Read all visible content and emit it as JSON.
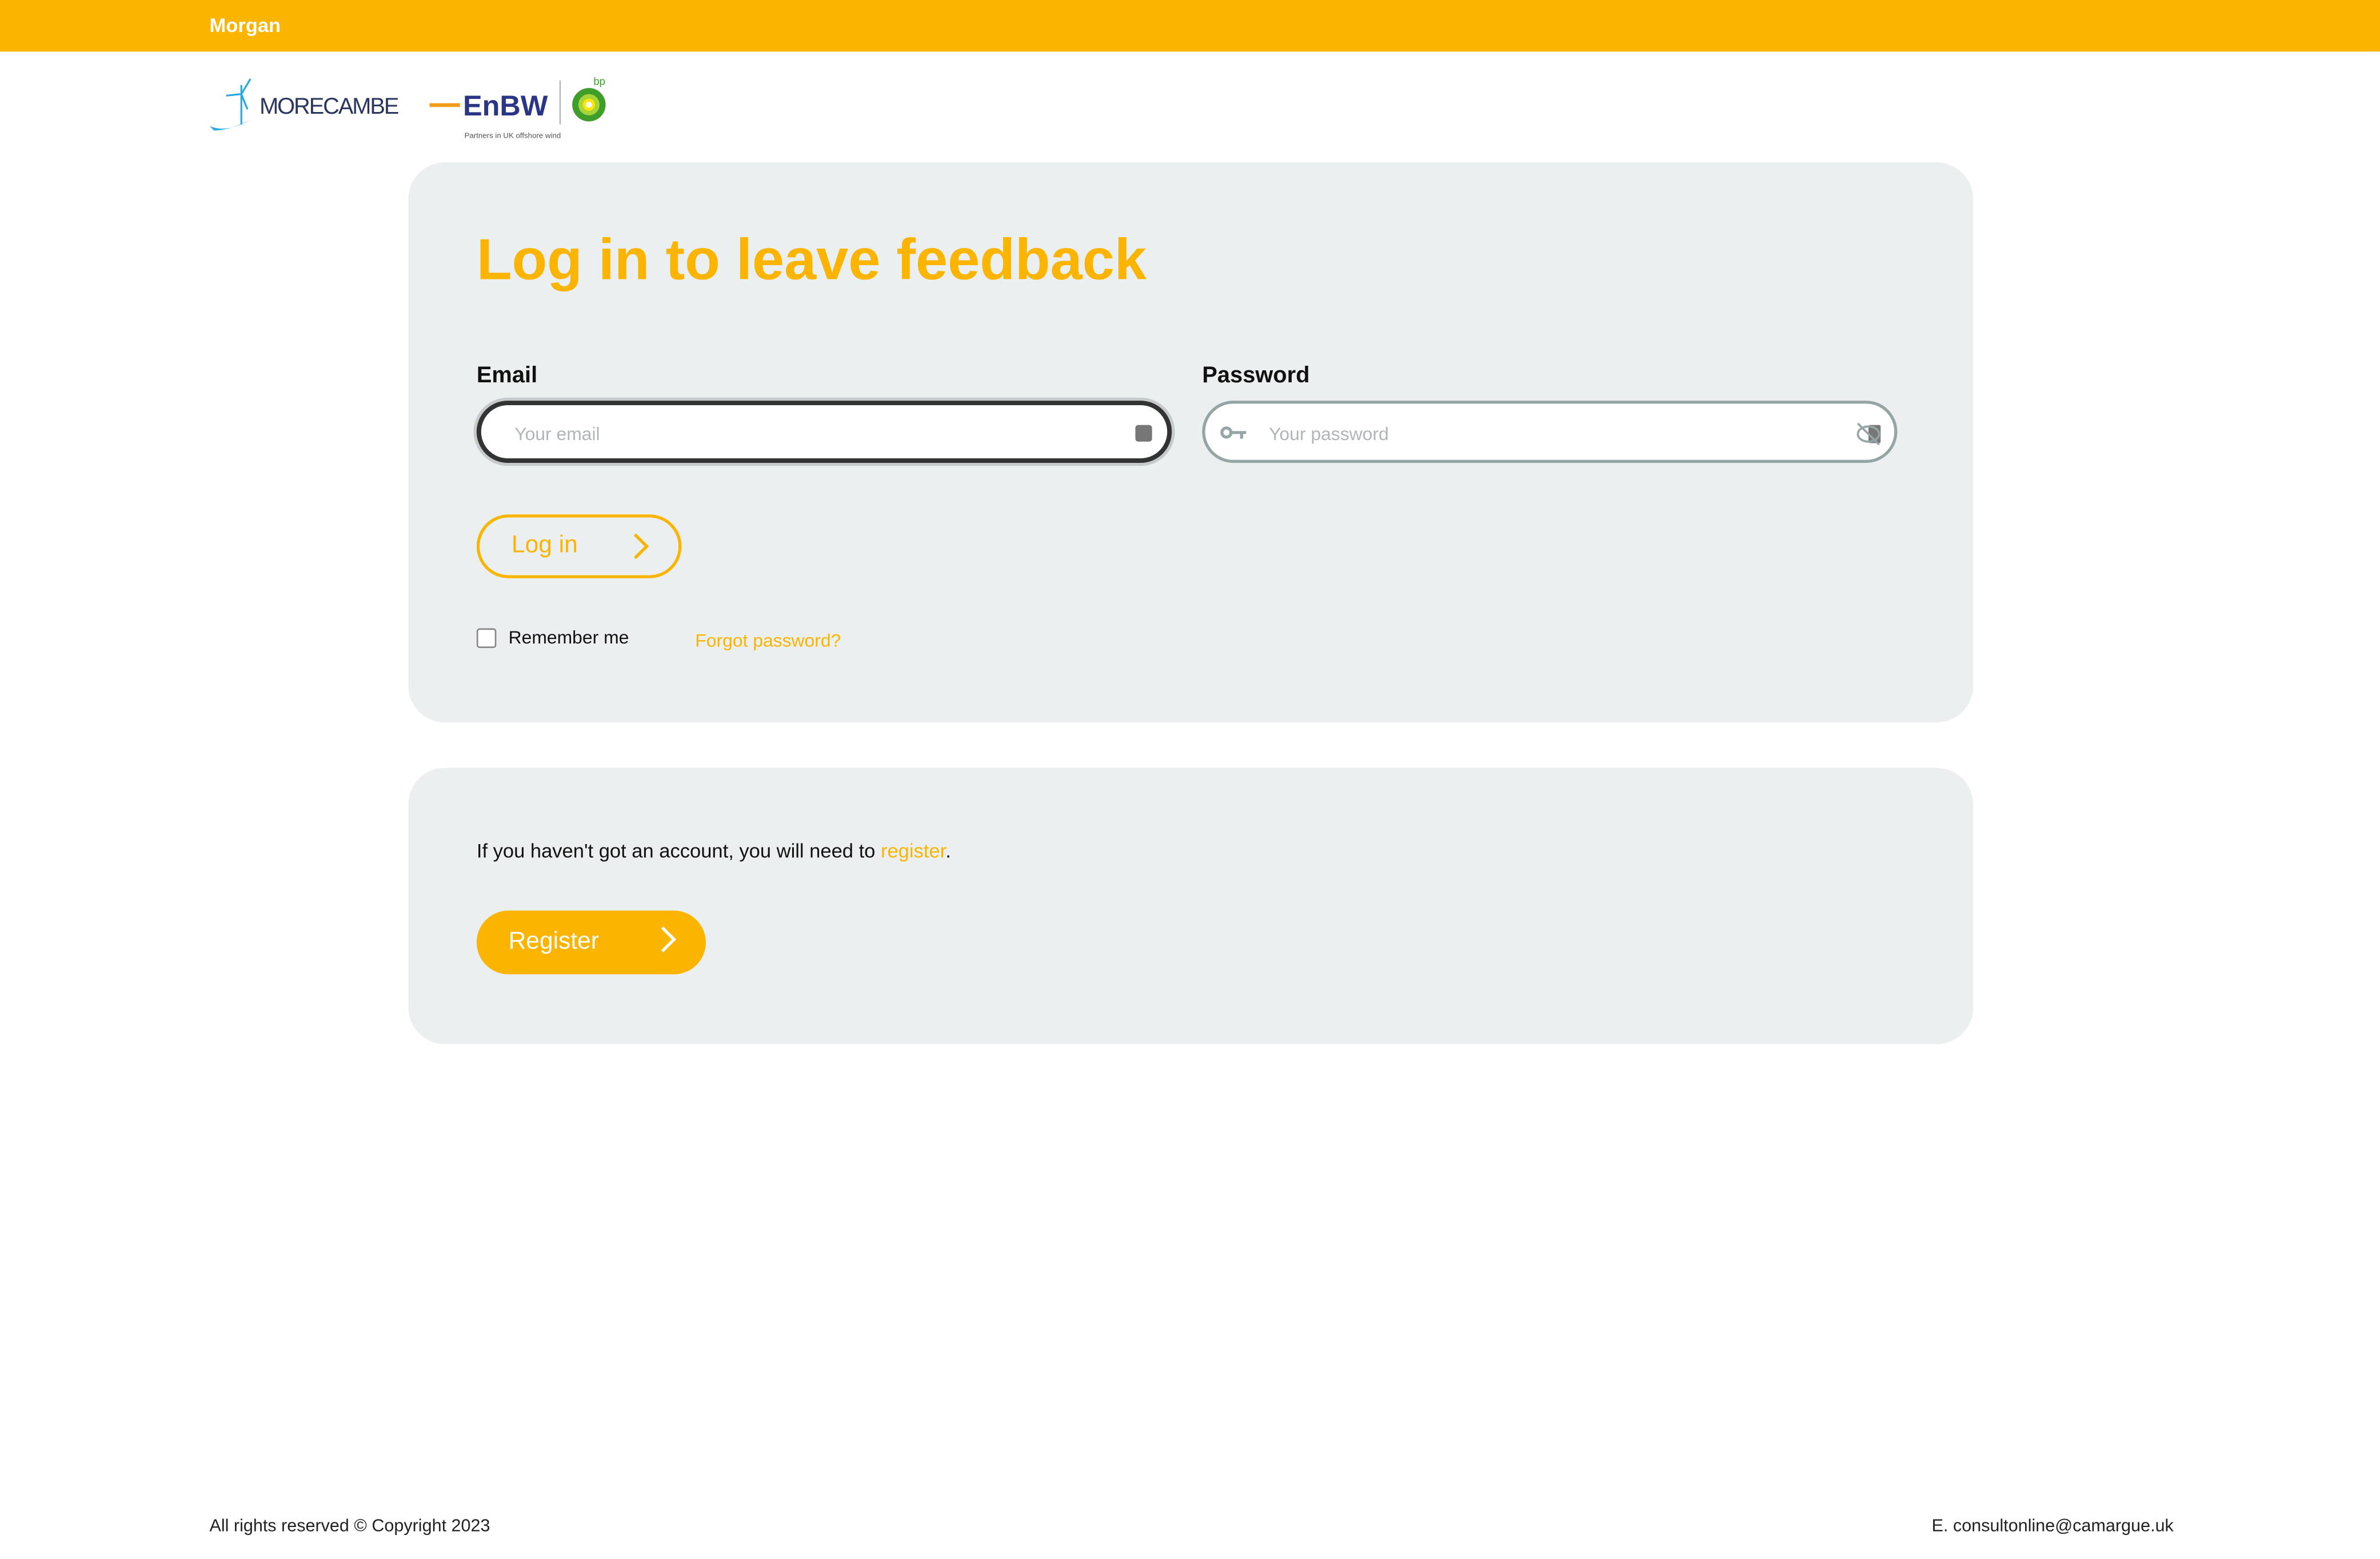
{
  "topbar": {
    "title": "Morgan"
  },
  "logos": {
    "morecambe": "MORECAMBE",
    "enbw": "EnBW",
    "bp": "bp",
    "tagline": "Partners in UK offshore wind"
  },
  "login": {
    "title": "Log in to leave feedback",
    "email_label": "Email",
    "email_placeholder": "Your email",
    "password_label": "Password",
    "password_placeholder": "Your password",
    "login_button": "Log in",
    "remember_label": "Remember me",
    "forgot_link": "Forgot password?"
  },
  "register": {
    "message_prefix": "If you haven't got an account, you will need to ",
    "message_link": "register",
    "message_suffix": ".",
    "button": "Register"
  },
  "footer": {
    "copyright": "All rights reserved © Copyright 2023",
    "contact": "E. consultonline@camargue.uk"
  },
  "colors": {
    "accent": "#fbb400",
    "card": "#eceff0"
  }
}
